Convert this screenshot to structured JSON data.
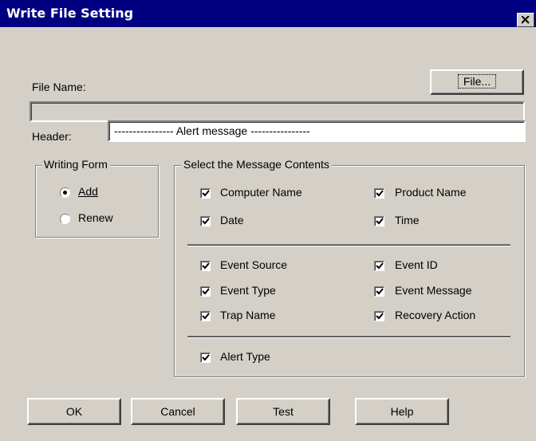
{
  "window": {
    "title": "Write File Setting"
  },
  "file": {
    "name_label": "File Name:",
    "browse_button": "File...",
    "name_value": ""
  },
  "header": {
    "label": "Header:",
    "value": "---------------- Alert message ----------------"
  },
  "writing_form": {
    "title": "Writing Form",
    "options": [
      {
        "label": "Add",
        "selected": true
      },
      {
        "label": "Renew",
        "selected": false
      }
    ]
  },
  "message_contents": {
    "title": "Select the Message Contents",
    "items": [
      {
        "label": "Computer Name",
        "checked": true
      },
      {
        "label": "Product Name",
        "checked": true
      },
      {
        "label": "Date",
        "checked": true
      },
      {
        "label": "Time",
        "checked": true
      },
      {
        "label": "Event Source",
        "checked": true
      },
      {
        "label": "Event ID",
        "checked": true
      },
      {
        "label": "Event Type",
        "checked": true
      },
      {
        "label": "Event Message",
        "checked": true
      },
      {
        "label": "Trap Name",
        "checked": true
      },
      {
        "label": "Recovery Action",
        "checked": true
      },
      {
        "label": "Alert Type",
        "checked": true
      }
    ]
  },
  "buttons": {
    "ok": "OK",
    "cancel": "Cancel",
    "test": "Test",
    "help": "Help"
  },
  "colors": {
    "titlebar": "#000080",
    "face": "#d4d0c8"
  }
}
